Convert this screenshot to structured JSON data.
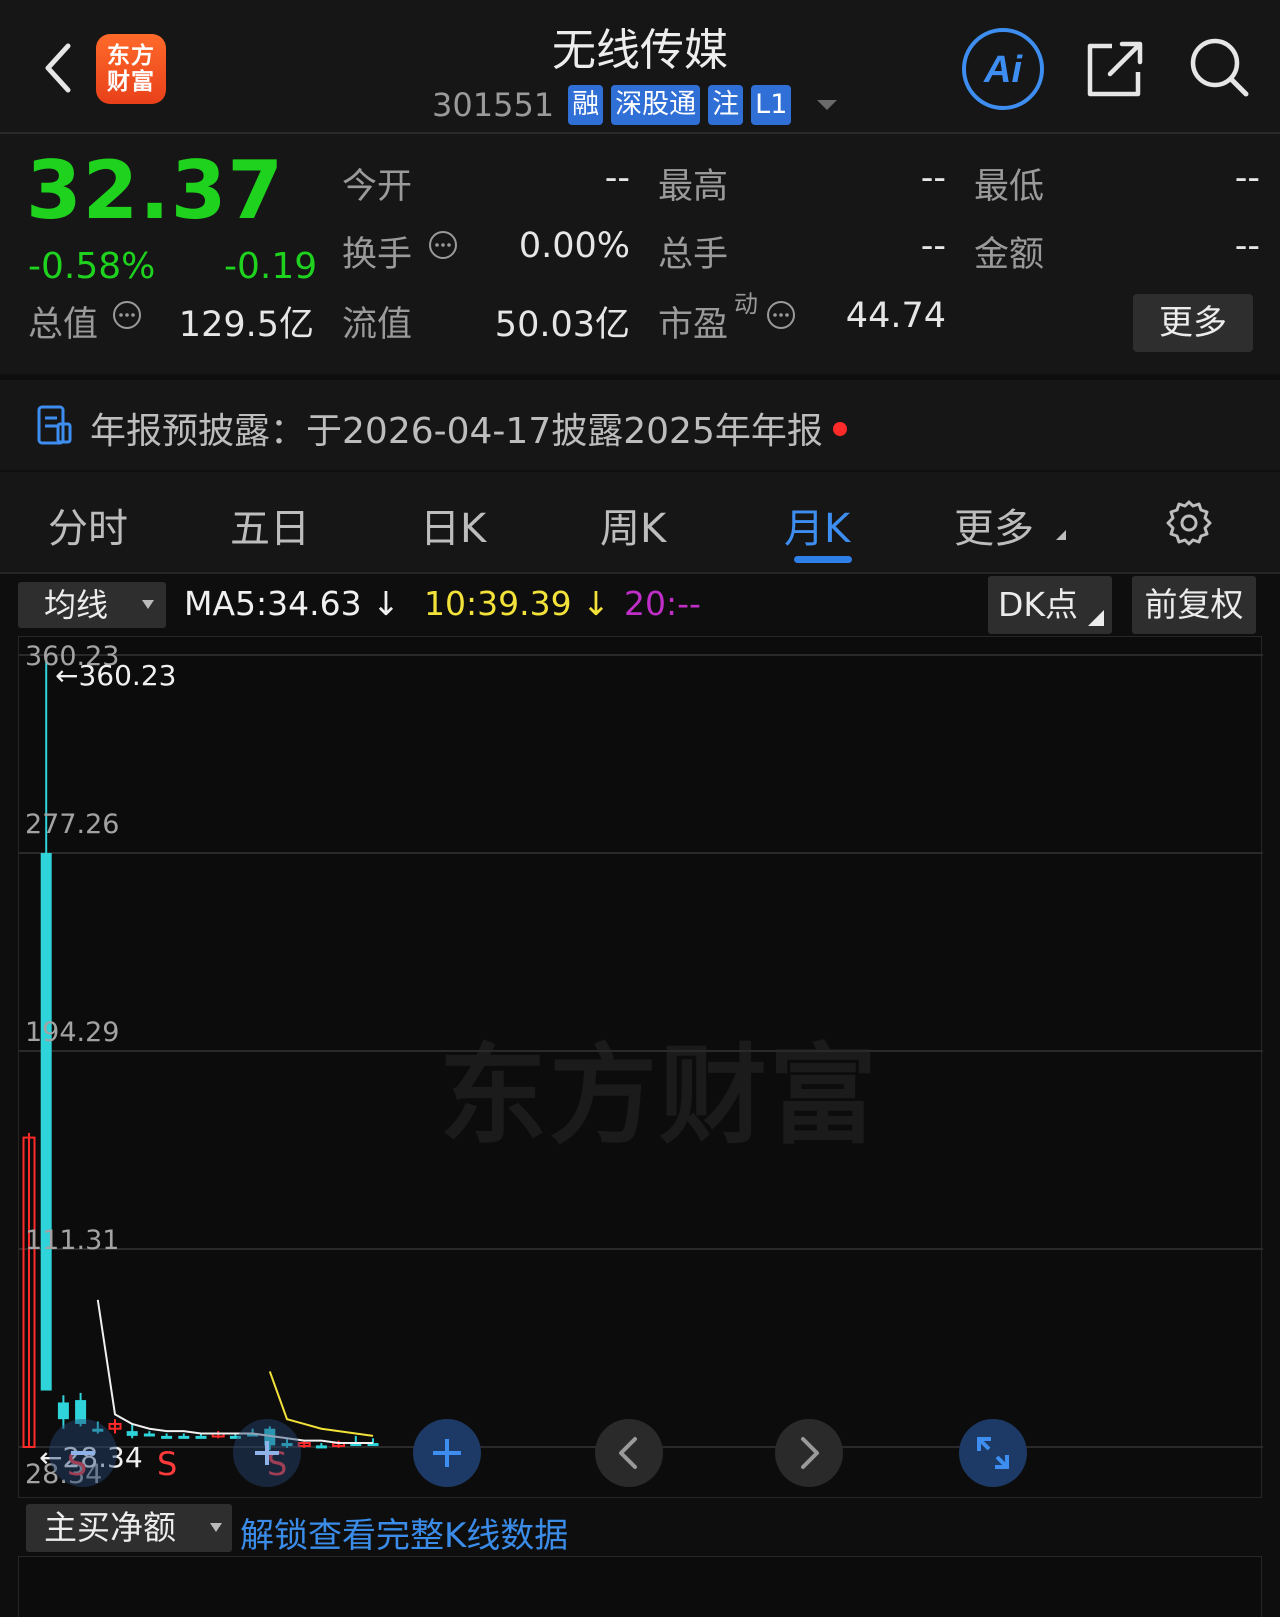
{
  "header": {
    "logo_text": "东方\n财富",
    "logo_line1": "东方",
    "logo_line2": "财富",
    "title": "无线传媒",
    "code": "301551",
    "tags": [
      "融",
      "深股通",
      "注",
      "L1"
    ],
    "icons": [
      "back-icon",
      "ai-icon",
      "share-icon",
      "search-icon"
    ]
  },
  "quote": {
    "price": "32.37",
    "change_pct": "-0.58%",
    "change": "-0.19",
    "fields": [
      {
        "label": "今开",
        "value": "--"
      },
      {
        "label": "最高",
        "value": "--"
      },
      {
        "label": "最低",
        "value": "--"
      },
      {
        "label": "换手",
        "value": "0.00%"
      },
      {
        "label": "总手",
        "value": "--"
      },
      {
        "label": "金额",
        "value": "--"
      },
      {
        "label": "总值",
        "value": "129.5亿"
      },
      {
        "label": "流值",
        "value": "50.03亿"
      },
      {
        "label": "市盈",
        "value": "44.74",
        "superscript": "动"
      }
    ],
    "more_label": "更多",
    "colors": {
      "down": "#1ed21e",
      "up": "#ff2a2a"
    }
  },
  "disclosure": {
    "label": "年报预披露：",
    "text": "于2026-04-17披露2025年年报"
  },
  "tabs": {
    "items": [
      "分时",
      "五日",
      "日K",
      "周K",
      "月K",
      "更多"
    ],
    "active": "月K"
  },
  "indicators": {
    "selector": "均线",
    "ma5": "MA5:34.63",
    "ma10": "10:39.39",
    "ma20": "20:--",
    "dk_label": "DK点",
    "adjust_label": "前复权"
  },
  "chart_data": {
    "type": "candlestick",
    "period": "month",
    "y_ticks": [
      "360.23",
      "277.26",
      "194.29",
      "111.31",
      "28.34"
    ],
    "ylim": [
      28.34,
      360.23
    ],
    "max_label": "360.23",
    "min_label": "28.34",
    "watermark": "东方财富",
    "signals": [
      "S",
      "S",
      "S"
    ],
    "candles": [
      {
        "open": 28.34,
        "high": 160,
        "low": 28.34,
        "close": 158,
        "color": "up"
      },
      {
        "open": 277.26,
        "high": 360.23,
        "low": 52,
        "close": 52,
        "color": "down"
      },
      {
        "open": 47,
        "high": 50,
        "low": 36,
        "close": 40,
        "color": "down"
      },
      {
        "open": 48,
        "high": 51,
        "low": 37,
        "close": 38,
        "color": "down"
      },
      {
        "open": 36,
        "high": 39,
        "low": 34,
        "close": 35,
        "color": "down"
      },
      {
        "open": 36,
        "high": 40,
        "low": 34,
        "close": 38,
        "color": "up"
      },
      {
        "open": 35,
        "high": 38,
        "low": 32,
        "close": 33,
        "color": "down"
      },
      {
        "open": 34,
        "high": 35,
        "low": 33,
        "close": 34,
        "color": "down"
      },
      {
        "open": 33,
        "high": 34,
        "low": 32,
        "close": 33,
        "color": "down"
      },
      {
        "open": 33,
        "high": 34,
        "low": 32,
        "close": 33,
        "color": "down"
      },
      {
        "open": 33,
        "high": 34,
        "low": 33,
        "close": 33,
        "color": "down"
      },
      {
        "open": 33,
        "high": 35,
        "low": 32,
        "close": 34,
        "color": "up"
      },
      {
        "open": 33,
        "high": 34,
        "low": 32,
        "close": 33,
        "color": "down"
      },
      {
        "open": 34,
        "high": 36,
        "low": 33,
        "close": 34,
        "color": "down"
      },
      {
        "open": 36,
        "high": 37,
        "low": 27,
        "close": 29,
        "color": "down"
      },
      {
        "open": 30,
        "high": 32,
        "low": 28,
        "close": 29,
        "color": "down"
      },
      {
        "open": 29,
        "high": 31,
        "low": 28,
        "close": 30,
        "color": "up"
      },
      {
        "open": 29,
        "high": 30,
        "low": 28,
        "close": 29,
        "color": "down"
      },
      {
        "open": 30,
        "high": 31,
        "low": 28,
        "close": 29,
        "color": "up"
      },
      {
        "open": 30,
        "high": 33,
        "low": 29,
        "close": 30,
        "color": "down"
      },
      {
        "open": 30,
        "high": 32,
        "low": 29,
        "close": 30,
        "color": "down"
      }
    ],
    "ma5": [
      null,
      null,
      null,
      null,
      90,
      42,
      38,
      36,
      35,
      35,
      34,
      34,
      34,
      34,
      33,
      32,
      31,
      31,
      30,
      30,
      30
    ],
    "ma10": [
      null,
      null,
      null,
      null,
      null,
      null,
      null,
      null,
      null,
      null,
      null,
      null,
      null,
      null,
      60,
      40,
      38,
      36,
      35,
      34,
      33
    ]
  },
  "nav": {
    "buttons": [
      "zoom-out-icon",
      "zoom-in-icon",
      "plus-icon",
      "chevron-left-icon",
      "chevron-right-icon",
      "expand-icon"
    ]
  },
  "sub_chart": {
    "selector": "主买净额",
    "unlock_text": "解锁查看完整K线数据"
  }
}
